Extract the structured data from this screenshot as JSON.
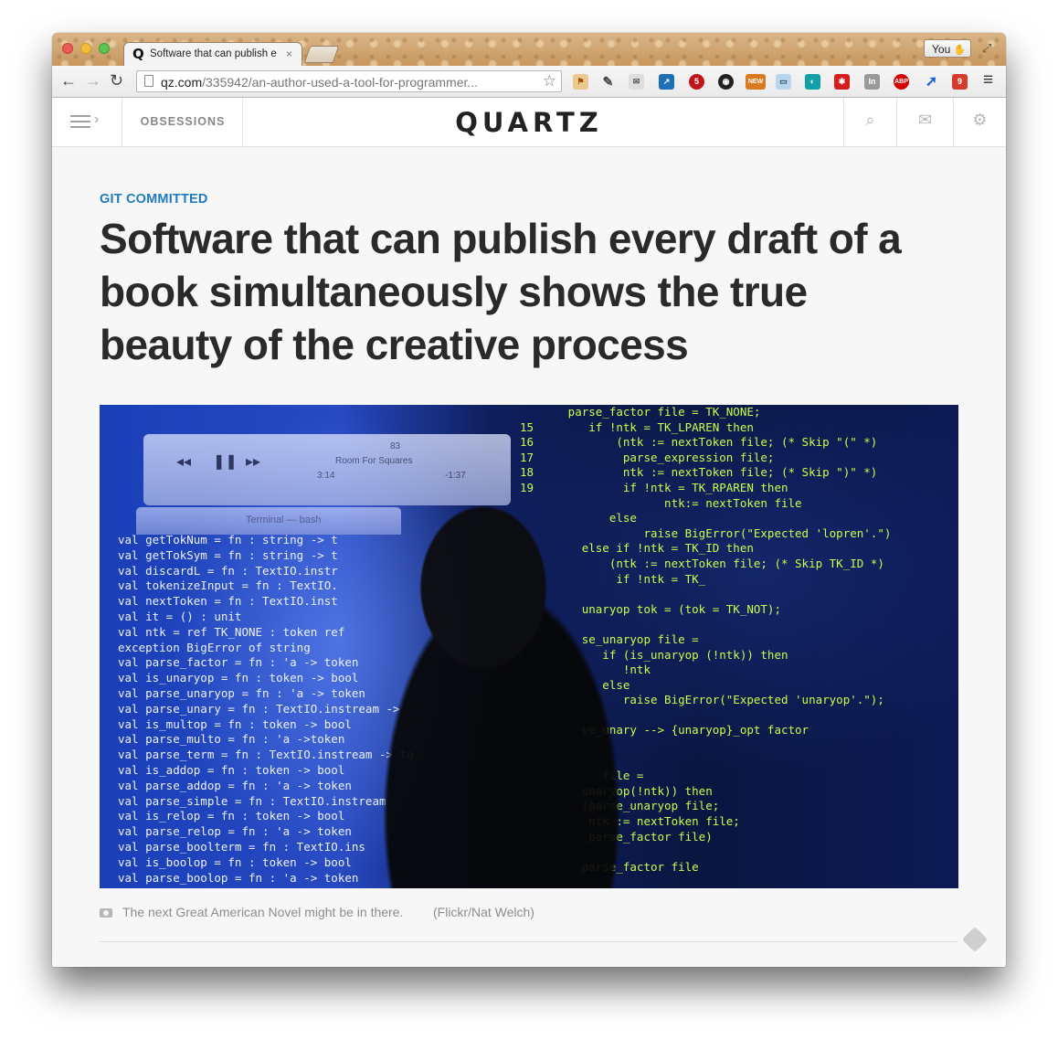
{
  "browser": {
    "tab_title": "Software that can publish e",
    "tab_favicon": "Q",
    "tab_close": "×",
    "profile_button": "You",
    "url_domain": "qz.com",
    "url_path": "/335942/an-author-used-a-tool-for-programmer...",
    "extension_badges": [
      "5",
      "NEW",
      "ABP",
      "5",
      "9"
    ]
  },
  "site": {
    "logo": "QUARTZ",
    "obsessions_label": "OBSESSIONS"
  },
  "article": {
    "kicker": "GIT COMMITTED",
    "headline": "Software that can publish every draft of a book simultaneously shows the true beauty of the creative process",
    "caption": "The next Great American Novel might be in there.",
    "credit": "(Flickr/Nat Welch)"
  },
  "hero_image": {
    "player_track": "Room For Squares",
    "player_number": "83",
    "player_time_elapsed": "3:14",
    "player_time_remaining": "-1:37",
    "terminal_title": "Terminal — bash",
    "code_left": "val getTokNum = fn : string -> t\nval getTokSym = fn : string -> t\nval discardL = fn : TextIO.instr\nval tokenizeInput = fn : TextIO.\nval nextToken = fn : TextIO.inst\nval it = () : unit\nval ntk = ref TK_NONE : token ref\nexception BigError of string\nval parse_factor = fn : 'a -> token\nval is_unaryop = fn : token -> bool\nval parse_unaryop = fn : 'a -> token\nval parse_unary = fn : TextIO.instream ->\nval is_multop = fn : token -> bool\nval parse_multo = fn : 'a ->token\nval parse_term = fn : TextIO.instream -> to\nval is_addop = fn : token -> bool\nval parse_addop = fn : 'a -> token\nval parse_simple = fn : TextIO.instream\nval is_relop = fn : token -> bool\nval parse_relop = fn : 'a -> token\nval parse_boolterm = fn : TextIO.ins\nval is_boolop = fn : token -> bool\nval parse_boolop = fn : 'a -> token",
    "code_right": "       parse_factor file = TK_NONE;\n15        if !ntk = TK_LPAREN then\n16            (ntk := nextToken file; (* Skip \"(\" *)\n17             parse_expression file;\n18             ntk := nextToken file; (* Skip \")\" *)\n19             if !ntk = TK_RPAREN then\n                     ntk:= nextToken file\n             else\n                  raise BigError(\"Expected 'lopren'.\")\n         else if !ntk = TK_ID then\n             (ntk := nextToken file; (* Skip TK_ID *)\n              if !ntk = TK_\n\n         unaryop tok = (tok = TK_NOT);\n\n         se_unaryop file =\n            if (is_unaryop (!ntk)) then\n               !ntk\n            else\n               raise BigError(\"Expected 'unaryop'.\");\n\n         ve_unary --> {unaryop}_opt factor\n\n\n            file =\n         unaryop(!ntk)) then\n         (parse_unaryop file;\n          ntk := nextToken file;\n          parse_factor file)\n\n         parse_factor file"
  },
  "colors": {
    "kicker": "#1e7bbf",
    "headline": "#2a2a2a",
    "code_green": "#c6ff4a"
  }
}
